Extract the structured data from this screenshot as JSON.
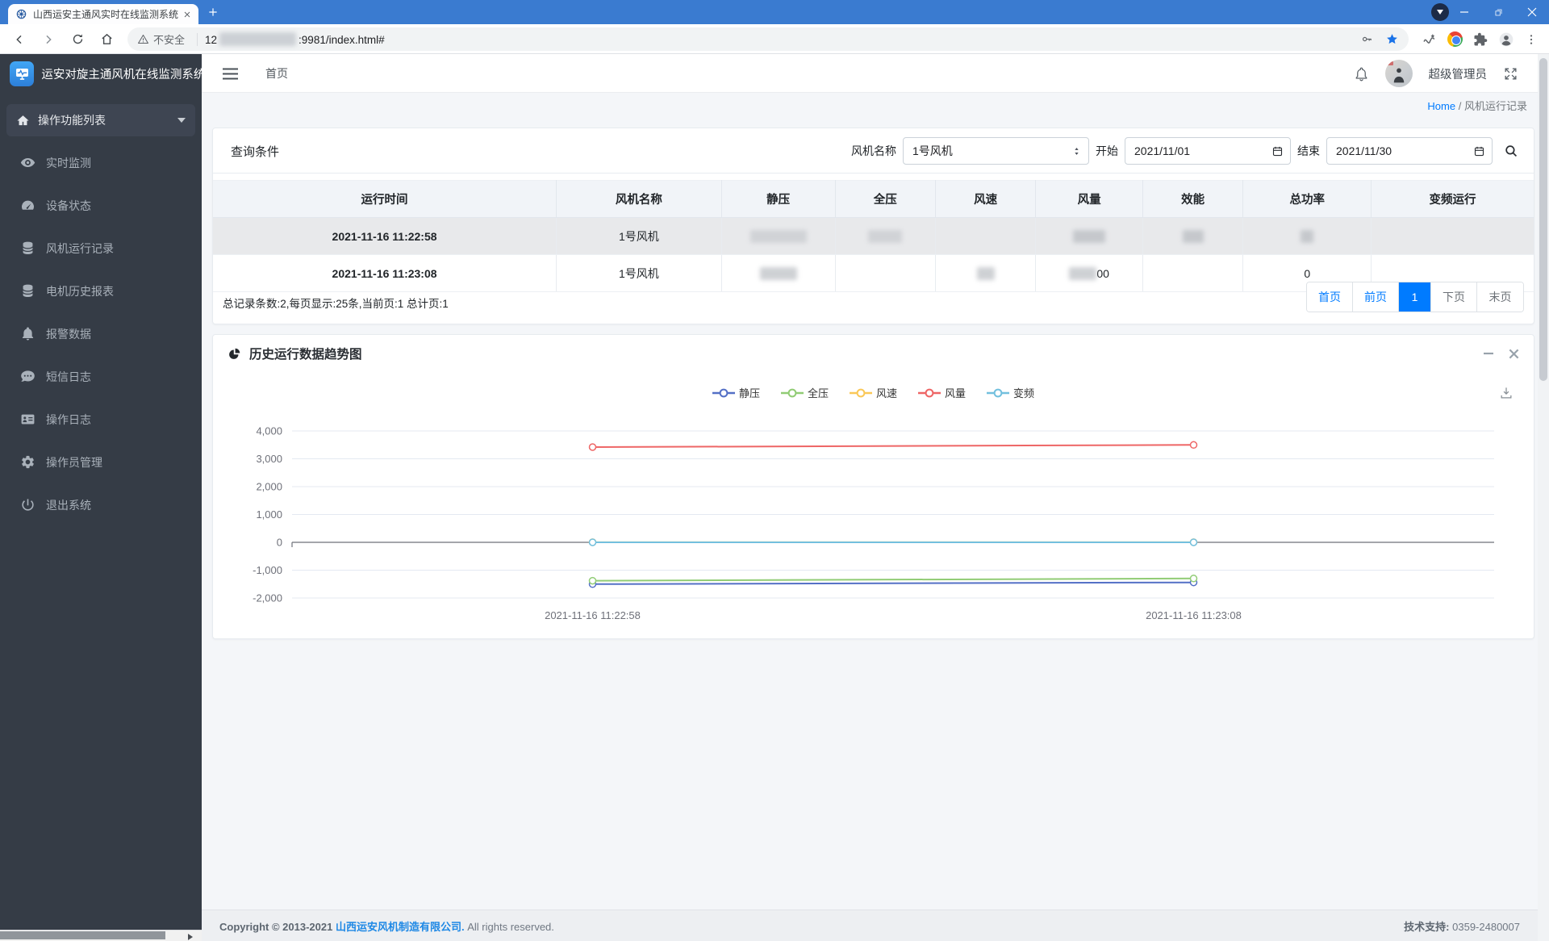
{
  "browser": {
    "tab_title": "山西运安主通风实时在线监测系统",
    "security_label": "不安全",
    "url_prefix": "12",
    "url_suffix": ":9981/index.html#",
    "url_redacted": true
  },
  "sidebar": {
    "app_title": "运安对旋主通风机在线监测系统",
    "menu_header": {
      "icon": "home-icon",
      "label": "操作功能列表"
    },
    "items": [
      {
        "icon": "eye-icon",
        "label": "实时监测"
      },
      {
        "icon": "gauge-icon",
        "label": "设备状态"
      },
      {
        "icon": "database-icon",
        "label": "风机运行记录"
      },
      {
        "icon": "database-icon",
        "label": "电机历史报表"
      },
      {
        "icon": "bell-icon",
        "label": "报警数据"
      },
      {
        "icon": "comment-icon",
        "label": "短信日志"
      },
      {
        "icon": "idcard-icon",
        "label": "操作日志"
      },
      {
        "icon": "gear-icon",
        "label": "操作员管理"
      },
      {
        "icon": "power-icon",
        "label": "退出系统"
      }
    ]
  },
  "topbar": {
    "home_label": "首页",
    "username": "超级管理员"
  },
  "breadcrumb": {
    "home": "Home",
    "separator": "/",
    "current": "风机运行记录"
  },
  "query": {
    "title": "查询条件",
    "fan_label": "风机名称",
    "fan_value": "1号风机",
    "start_label": "开始",
    "start_value": "2021/11/01",
    "end_label": "结束",
    "end_value": "2021/11/30"
  },
  "table": {
    "headers": [
      "运行时间",
      "风机名称",
      "静压",
      "全压",
      "风速",
      "风量",
      "效能",
      "总功率",
      "变频运行"
    ],
    "rows": [
      {
        "selected": true,
        "cells": [
          {
            "text": "2021-11-16 11:22:58",
            "bold": true
          },
          {
            "text": "1号风机"
          },
          {
            "blur_w": 70,
            "faint": true
          },
          {
            "blur_w": 42,
            "faint": true
          },
          {},
          {
            "blur_w": 40
          },
          {
            "blur_w": 26
          },
          {
            "blur_w": 16
          },
          {}
        ]
      },
      {
        "selected": false,
        "cells": [
          {
            "text": "2021-11-16 11:23:08",
            "bold": true
          },
          {
            "text": "1号风机"
          },
          {
            "blur_w": 46
          },
          {},
          {
            "blur_w": 22
          },
          {
            "blur_w": 34,
            "text": "00"
          },
          {},
          {
            "text": "0"
          },
          {}
        ]
      }
    ],
    "summary": "总记录条数:2,每页显示:25条,当前页:1 总计页:1"
  },
  "pagination": {
    "first": "首页",
    "prev": "前页",
    "page": "1",
    "next": "下页",
    "last": "末页"
  },
  "chart_card": {
    "title": "历史运行数据趋势图"
  },
  "chart_data": {
    "type": "line",
    "title": "历史运行数据趋势图",
    "x": [
      "2021-11-16 11:22:58",
      "2021-11-16 11:23:08"
    ],
    "ylim": [
      -2000,
      4000
    ],
    "ytick_values": [
      4000,
      3000,
      2000,
      1000,
      0,
      -1000,
      -2000
    ],
    "ytick_labels": [
      "4,000",
      "3,000",
      "2,000",
      "1,000",
      "0",
      "-1,000",
      "-2,000"
    ],
    "grid": true,
    "legend_position": "top",
    "series": [
      {
        "name": "静压",
        "color": "#5470c6",
        "values": [
          -1500,
          -1440
        ]
      },
      {
        "name": "全压",
        "color": "#91cc75",
        "values": [
          -1380,
          -1300
        ]
      },
      {
        "name": "风速",
        "color": "#fac858",
        "values": [
          3,
          3
        ]
      },
      {
        "name": "风量",
        "color": "#ee6666",
        "values": [
          3420,
          3500
        ]
      },
      {
        "name": "变频",
        "color": "#73c0de",
        "values": [
          0,
          0
        ]
      }
    ]
  },
  "footer": {
    "copyright_prefix": "Copyright © 2013-2021",
    "company": "山西运安风机制造有限公司.",
    "rights": "All rights reserved.",
    "support_label": "技术支持:",
    "support_phone": "0359-2480007"
  }
}
